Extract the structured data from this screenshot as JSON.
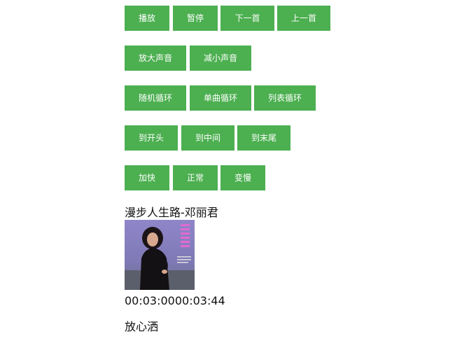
{
  "controls": {
    "row1": [
      "播放",
      "暂停",
      "下一首",
      "上一首"
    ],
    "row2": [
      "放大声音",
      "减小声音"
    ],
    "row3": [
      "随机循环",
      "单曲循环",
      "列表循环"
    ],
    "row4": [
      "到开头",
      "到中间",
      "到末尾"
    ],
    "row5": [
      "加快",
      "正常",
      "变慢"
    ]
  },
  "player": {
    "song_title": "漫步人生路-邓丽君",
    "time": "00:03:0000:03:44",
    "next_song": "放心洒"
  },
  "colors": {
    "button_bg": "#4CAF50",
    "button_text": "#ffffff"
  }
}
